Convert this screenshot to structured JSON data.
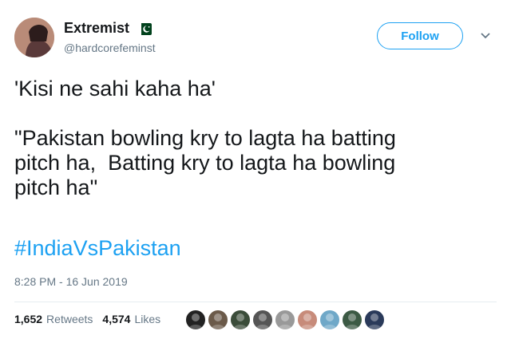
{
  "user": {
    "display_name": "Extremist",
    "handle": "@hardcorefeminst",
    "flag_icon": "pakistan-flag-icon"
  },
  "follow_label": "Follow",
  "tweet": {
    "body": "'Kisi ne sahi kaha ha'\n\n\"Pakistan bowling kry to lagta ha batting\npitch ha,  Batting kry to lagta ha bowling\npitch ha\"",
    "hashtag": "#IndiaVsPakistan",
    "timestamp": "8:28 PM - 16 Jun 2019"
  },
  "stats": {
    "retweets_count": "1,652",
    "retweets_label": "Retweets",
    "likes_count": "4,574",
    "likes_label": "Likes"
  },
  "colors": {
    "accent": "#1da1f2",
    "text": "#14171a",
    "secondary": "#657786"
  },
  "likers": [
    {
      "color": "#222222",
      "icon": "liker-avatar-1"
    },
    {
      "color": "#6b5a4a",
      "icon": "liker-avatar-2"
    },
    {
      "color": "#3b4d3a",
      "icon": "liker-avatar-3"
    },
    {
      "color": "#555555",
      "icon": "liker-avatar-4"
    },
    {
      "color": "#999999",
      "icon": "liker-avatar-5"
    },
    {
      "color": "#c78b7a",
      "icon": "liker-avatar-6"
    },
    {
      "color": "#6fa8c8",
      "icon": "liker-avatar-7"
    },
    {
      "color": "#3c5a44",
      "icon": "liker-avatar-8"
    },
    {
      "color": "#2a3a5a",
      "icon": "liker-avatar-9"
    }
  ]
}
